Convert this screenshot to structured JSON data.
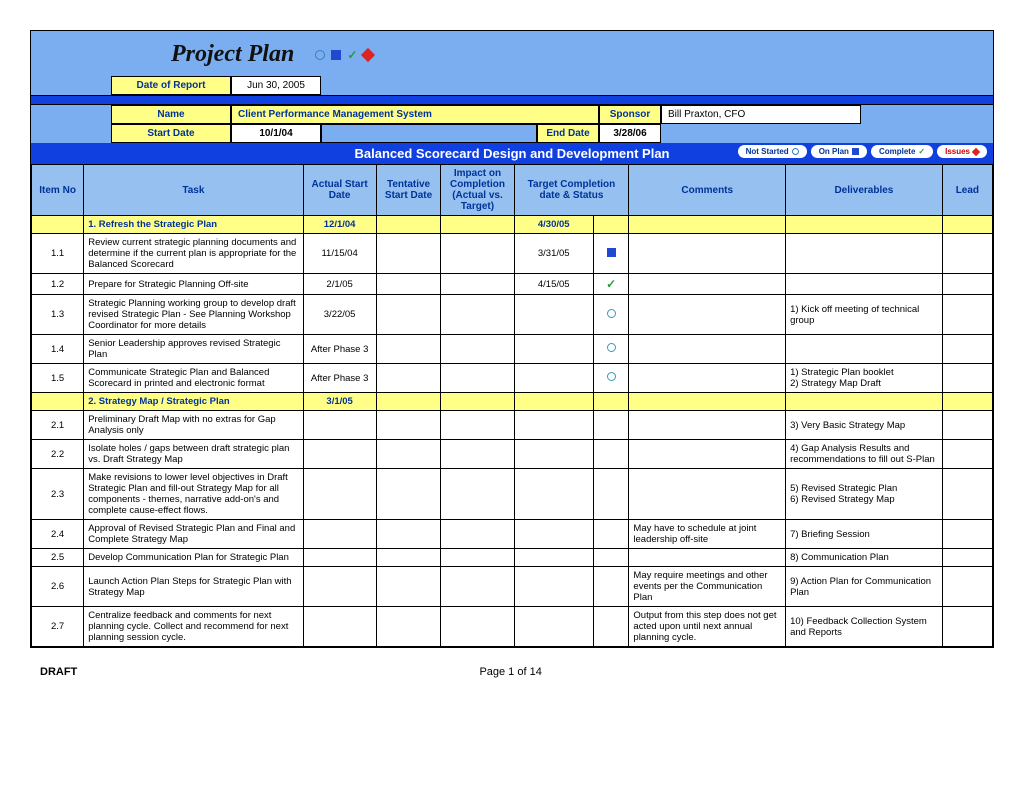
{
  "title": "Project Plan",
  "meta": {
    "date_of_report_label": "Date of Report",
    "date_of_report": "Jun 30, 2005",
    "name_label": "Name",
    "name": "Client Performance Management System",
    "sponsor_label": "Sponsor",
    "sponsor": "Bill Praxton, CFO",
    "start_date_label": "Start Date",
    "start_date": "10/1/04",
    "end_date_label": "End Date",
    "end_date": "3/28/06"
  },
  "section_title": "Balanced Scorecard Design and Development Plan",
  "legend": {
    "not_started": "Not Started",
    "on_plan": "On Plan",
    "complete": "Complete",
    "issues": "Issues"
  },
  "headers": {
    "item_no": "Item No",
    "task": "Task",
    "actual_start": "Actual Start Date",
    "tentative_start": "Tentative Start Date",
    "impact": "Impact on Completion (Actual vs. Target)",
    "target": "Target Completion date & Status",
    "comments": "Comments",
    "deliverables": "Deliverables",
    "lead": "Lead"
  },
  "sections": [
    {
      "label": "1. Refresh the Strategic Plan",
      "actual_start": "12/1/04",
      "target": "4/30/05",
      "rows": [
        {
          "item": "1.1",
          "task": "Review current strategic planning documents and determine if the current plan is appropriate for the Balanced Scorecard",
          "actual_start": "11/15/04",
          "target": "3/31/05",
          "status": "square",
          "deliverables": ""
        },
        {
          "item": "1.2",
          "task": "Prepare for Strategic Planning Off-site",
          "actual_start": "2/1/05",
          "target": "4/15/05",
          "status": "check",
          "deliverables": ""
        },
        {
          "item": "1.3",
          "task": "Strategic Planning working group to develop draft revised Strategic Plan - See Planning Workshop Coordinator for more details",
          "actual_start": "3/22/05",
          "status": "circle",
          "deliverables": "1) Kick off meeting of technical group"
        },
        {
          "item": "1.4",
          "task": "Senior Leadership approves revised Strategic Plan",
          "actual_start": "After Phase 3",
          "status": "circle",
          "deliverables": ""
        },
        {
          "item": "1.5",
          "task": "Communicate Strategic Plan and Balanced Scorecard in printed and electronic format",
          "actual_start": "After Phase 3",
          "status": "circle",
          "deliverables": "1) Strategic Plan booklet\n2) Strategy Map Draft"
        }
      ]
    },
    {
      "label": "2. Strategy Map / Strategic Plan",
      "actual_start": "3/1/05",
      "rows": [
        {
          "item": "2.1",
          "task": "Preliminary Draft Map with no extras for Gap Analysis only",
          "deliverables": "3) Very Basic Strategy Map"
        },
        {
          "item": "2.2",
          "task": "Isolate holes / gaps between draft strategic plan vs. Draft Strategy Map",
          "deliverables": "4) Gap Analysis Results and recommendations to fill out S-Plan"
        },
        {
          "item": "2.3",
          "task": "Make revisions to lower level objectives in Draft Strategic Plan and fill-out Strategy Map for all components - themes, narrative add-on's and complete cause-effect flows.",
          "deliverables": "5) Revised Strategic Plan\n6) Revised Strategy Map"
        },
        {
          "item": "2.4",
          "task": "Approval of Revised Strategic Plan and Final and Complete Strategy Map",
          "comments": "May have to schedule at joint leadership off-site",
          "deliverables": "7) Briefing Session"
        },
        {
          "item": "2.5",
          "task": "Develop Communication Plan for Strategic Plan",
          "deliverables": "8) Communication Plan"
        },
        {
          "item": "2.6",
          "task": "Launch Action Plan Steps for Strategic Plan with Strategy Map",
          "comments": "May require meetings and other events per the Communication Plan",
          "deliverables": "9) Action Plan for Communication Plan"
        },
        {
          "item": "2.7",
          "task": "Centralize feedback and comments for next planning cycle. Collect and recommend for next planning session cycle.",
          "comments": "Output from this step does not get acted upon until next annual planning cycle.",
          "deliverables": "10) Feedback Collection System and Reports"
        }
      ]
    }
  ],
  "footer": {
    "draft": "DRAFT",
    "page": "Page 1 of 14"
  }
}
